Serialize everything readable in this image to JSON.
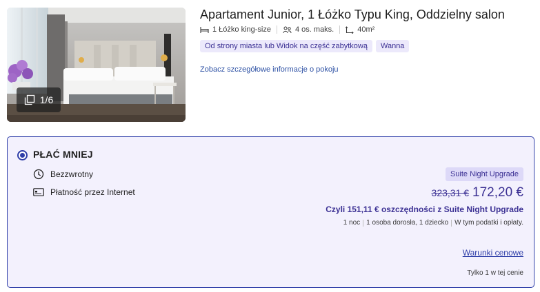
{
  "room": {
    "title": "Apartament Junior, 1 Łóżko Typu King, Oddzielny salon",
    "photo_counter": "1/6",
    "specs": {
      "bed": "1 Łóżko king-size",
      "occupancy": "4 os. maks.",
      "area": "40m²"
    },
    "tags": [
      "Od strony miasta lub Widok na część zabytkową",
      "Wanna"
    ],
    "details_link": "Zobacz szczegółowe informacje o pokoju"
  },
  "rate": {
    "name": "PŁAĆ MNIEJ",
    "selected": true,
    "features": {
      "refund": "Bezzwrotny",
      "payment": "Płatność przez Internet"
    },
    "upgrade_badge": "Suite Night Upgrade",
    "old_price": "323,31 €",
    "new_price": "172,20 €",
    "savings": "Czyli 151,11 € oszczędności z Suite Night Upgrade",
    "details": {
      "nights": "1 noc",
      "guests": "1 osoba dorosła, 1 dziecko",
      "taxes": "W tym podatki i opłaty."
    },
    "conditions_link": "Warunki cenowe",
    "availability": "Tylko 1 w tej cenie"
  },
  "icons": {
    "bed": "bed-icon",
    "occupancy": "people-icon",
    "area": "area-icon",
    "refund": "clock-icon",
    "payment": "credit-card-icon",
    "gallery": "gallery-icon"
  },
  "colors": {
    "accent": "#2e3ea8",
    "price": "#3c3194",
    "card_bg": "#f3f1fd",
    "tag_bg": "#ece9fb"
  }
}
